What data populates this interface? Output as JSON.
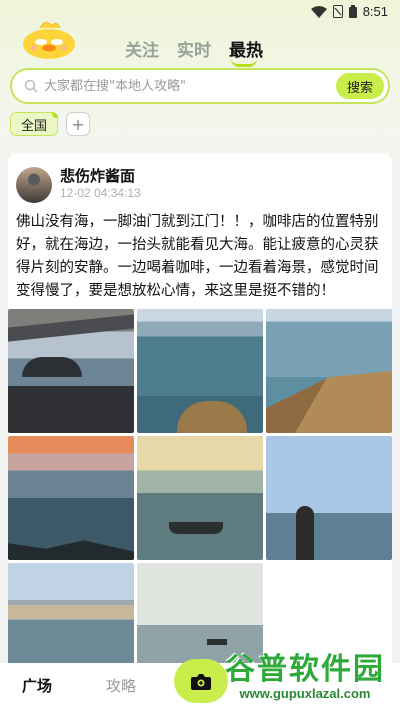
{
  "status_bar": {
    "time": "8:51"
  },
  "tabs": [
    {
      "label": "关注",
      "active": false
    },
    {
      "label": "实时",
      "active": false
    },
    {
      "label": "最热",
      "active": true
    }
  ],
  "search": {
    "placeholder": "大家都在搜\"本地人攻略\"",
    "button_label": "搜索"
  },
  "region": {
    "selected": "全国",
    "add_label": "+"
  },
  "post": {
    "author": "悲伤炸酱面",
    "time": "12-02 04:34:13",
    "text": "佛山没有海，一脚油门就到江门！！，咖啡店的位置特别好，就在海边，一抬头就能看见大海。能让疲意的心灵获得片刻的安静。一边喝着咖啡，一边看着海景，感觉时间变得慢了，要是想放松心情，来这里是挺不错的！"
  },
  "bottom_nav": {
    "square_label": "广场",
    "guide_label": "攻略"
  },
  "watermark": {
    "title": "谷普软件园",
    "url": "www.gupuxlazal.com"
  },
  "colors": {
    "accent": "#c9ee4c",
    "accent_border": "#c6e45a"
  }
}
